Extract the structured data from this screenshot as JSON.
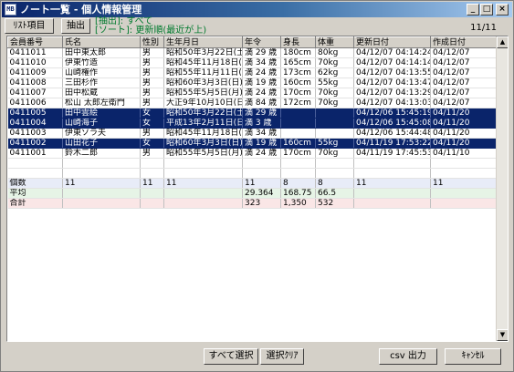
{
  "window": {
    "title": "ノート一覧 - 個人情報管理",
    "icon_text": "MB"
  },
  "window_buttons": {
    "minimize": "_",
    "maximize": "□",
    "close": "×"
  },
  "toolbar": {
    "list_items_label": "ﾘｽﾄ項目",
    "extract_label": "抽出",
    "filter_text": "[抽出]: すべて",
    "sort_text": "[ソート]: 更新順(最近が上)",
    "count_text": "11/11"
  },
  "table": {
    "columns": [
      "会員番号",
      "氏名",
      "性別",
      "生年月日",
      "年令",
      "身長",
      "体重",
      "更新日付",
      "作成日付"
    ],
    "rows": [
      [
        "0411011",
        "田中東太郎",
        "男",
        "昭和50年3月22日(土",
        "満 29 歳",
        "180cm",
        "80kg",
        "04/12/07 04:14:24",
        "04/12/07"
      ],
      [
        "0411010",
        "伊東竹造",
        "男",
        "昭和45年11月18日(水",
        "満 34 歳",
        "165cm",
        "70kg",
        "04/12/07 04:14:14",
        "04/12/07"
      ],
      [
        "0411009",
        "山崎権作",
        "男",
        "昭和55年11月11日(火",
        "満 24 歳",
        "173cm",
        "62kg",
        "04/12/07 04:13:55",
        "04/12/07"
      ],
      [
        "0411008",
        "三田杉作",
        "男",
        "昭和60年3月3日(日)",
        "満 19 歳",
        "160cm",
        "55kg",
        "04/12/07 04:13:47",
        "04/12/07"
      ],
      [
        "0411007",
        "田中松蔵",
        "男",
        "昭和55年5月5日(月)",
        "満 24 歳",
        "170cm",
        "70kg",
        "04/12/07 04:13:29",
        "04/12/07"
      ],
      [
        "0411006",
        "松山 太郎左衛門",
        "男",
        "大正9年10月10日(日",
        "満 84 歳",
        "172cm",
        "70kg",
        "04/12/07 04:13:03",
        "04/12/07"
      ],
      [
        "0411005",
        "田中雲絵",
        "女",
        "昭和50年3月22日(土",
        "満 29 歳",
        "",
        "",
        "04/12/06 15:45:19",
        "04/11/20"
      ],
      [
        "0411004",
        "山崎海子",
        "女",
        "平成13年2月11日(日",
        "満 3 歳",
        "",
        "",
        "04/12/06 15:45:08",
        "04/11/20"
      ],
      [
        "0411003",
        "伊東ソラ夫",
        "男",
        "昭和45年11月18日(水",
        "満 34 歳",
        "",
        "",
        "04/12/06 15:44:48",
        "04/11/20"
      ],
      [
        "0411002",
        "山田花子",
        "女",
        "昭和60年3月3日(日)",
        "満 19 歳",
        "160cm",
        "55kg",
        "04/11/19 17:53:22",
        "04/11/20"
      ],
      [
        "0411001",
        "鈴木二郎",
        "男",
        "昭和55年5月5日(月)",
        "満 24 歳",
        "170cm",
        "70kg",
        "04/11/19 17:45:53",
        "04/11/10"
      ]
    ],
    "selected_row_indices": [
      6,
      7,
      9
    ],
    "summary": [
      [
        "個数",
        "11",
        "11",
        "11",
        "11",
        "8",
        "8",
        "11",
        "11"
      ],
      [
        "平均",
        "",
        "",
        "",
        "29.364",
        "168.75",
        "66.5",
        "",
        ""
      ],
      [
        "合計",
        "",
        "",
        "",
        "323",
        "1,350",
        "532",
        "",
        ""
      ]
    ]
  },
  "scrollbar": {
    "up_arrow": "▲",
    "down_arrow": "▼"
  },
  "buttons": {
    "select_all": "すべて選択",
    "clear_selection": "選択ｸﾘｱ",
    "csv_output": "csv 出力",
    "cancel": "ｷｬﾝｾﾙ"
  }
}
